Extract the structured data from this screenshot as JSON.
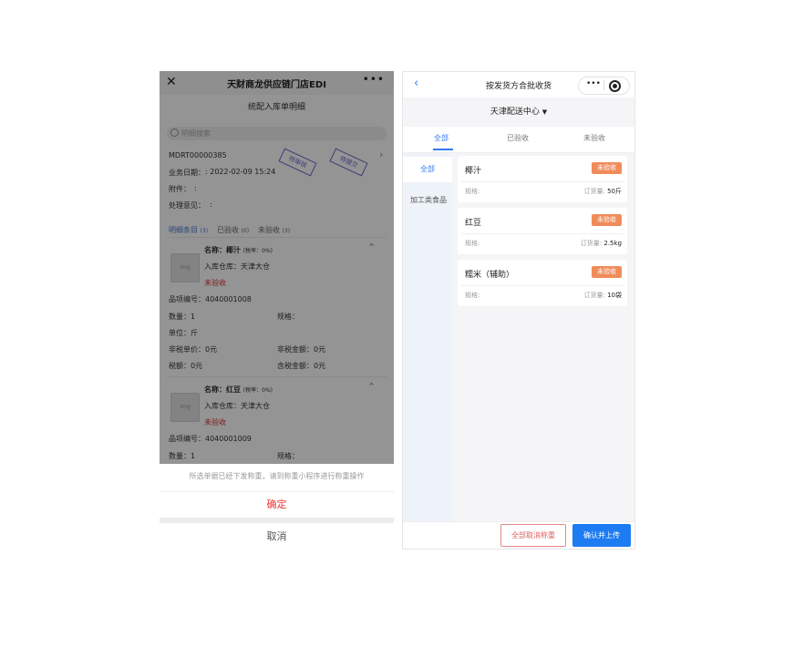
{
  "left": {
    "nav": {
      "close": "✕",
      "title": "天财商龙供应链门店EDI",
      "more": "•••"
    },
    "subtitle": "统配入库单明细",
    "search_placeholder": "明细搜索",
    "order_no": "MDRT00000385",
    "date_label": "业务日期：",
    "date_value": ": 2022-02-09 15:24",
    "attach_label": "附件：",
    "attach_value": ":",
    "opinion_label": "处理意见：",
    "opinion_value": ":",
    "stamps": [
      "待审核",
      "待提交"
    ],
    "tabs": {
      "detail": "明细条目",
      "detail_count": "(3)",
      "checked": "已验收",
      "checked_count": "(0)",
      "unchecked": "未验收",
      "unchecked_count": "(3)"
    },
    "items": [
      {
        "name_label": "名称：",
        "name": "椰汁",
        "tax": "(税率：0%)",
        "warehouse": "入库仓库：天津大仓",
        "status": "未验收",
        "code": "品项编号：4040001008",
        "qty": "数量：1",
        "spec": "规格：",
        "unit": "单位：斤",
        "price": "非税单价：0元",
        "amount": "非税金额：0元",
        "tax_amount": "税额：0元",
        "total": "含税金额：0元"
      },
      {
        "name_label": "名称：",
        "name": "红豆",
        "tax": "(税率：0%)",
        "warehouse": "入库仓库：天津大仓",
        "status": "未验收",
        "code": "品项编号：4040001009",
        "qty": "数量：1",
        "spec": "规格："
      }
    ],
    "sheet": {
      "tip": "所选单据已经下发称重，请到称重小程序进行称重操作",
      "confirm": "确定",
      "cancel": "取消"
    }
  },
  "right": {
    "nav": {
      "back": "‹",
      "title": "按发货方合批收货"
    },
    "center": "天津配送中心",
    "tabs": [
      "全部",
      "已验收",
      "未验收"
    ],
    "active_tab": "全部",
    "categories": [
      "全部",
      "加工类食品"
    ],
    "products": [
      {
        "name": "椰汁",
        "status": "未验收",
        "spec": "规格:",
        "qty_label": "订货量:",
        "qty": "50斤"
      },
      {
        "name": "红豆",
        "status": "未验收",
        "spec": "规格:",
        "qty_label": "订货量:",
        "qty": "2.5kg"
      },
      {
        "name": "糯米（辅助）",
        "status": "未验收",
        "spec": "规格:",
        "qty_label": "订货量:",
        "qty": "10袋"
      }
    ],
    "buttons": {
      "cancel_all": "全部取消称重",
      "confirm_upload": "确认并上传"
    },
    "colors": {
      "accent": "#1d7cf2",
      "badge": "#f08c5a"
    }
  }
}
